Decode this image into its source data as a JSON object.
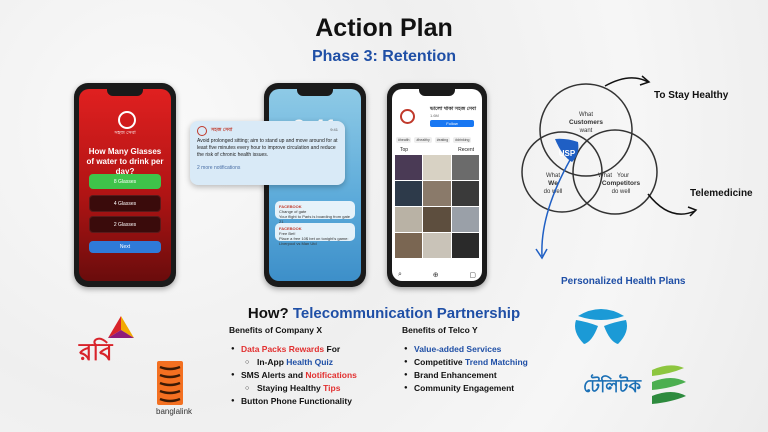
{
  "title": "Action Plan",
  "subtitle": "Phase 3: Retention",
  "phone1": {
    "app_name": "সহজ সেবা",
    "question": "How Many Glasses of water to drink per day?",
    "options": [
      "8 Glasses",
      "4 Glasses",
      "2 Glasses"
    ],
    "next_label": "Next"
  },
  "phone2": {
    "time": "9:41",
    "notification": {
      "app": "সহজ সেবা",
      "time": "9:41",
      "body": "Avoid prolonged sitting; aim to stand up and move around for at least five minutes every hour to improve circulation and reduce the risk of chronic health issues.",
      "more": "2 more notifications"
    },
    "small_notifications": [
      {
        "head": "FACEBOOK",
        "line1": "Change of gate",
        "line2": "Your flight to Paris is boarding from gate 21"
      },
      {
        "head": "FACEBOOK",
        "line1": "Free Bet!",
        "line2": "Place a free 10$ bet on tonight's game: Liverpool vs Man Utd"
      }
    ]
  },
  "phone3": {
    "page_title": "ভালো থাকা সহজ সেবা",
    "followers": "1.6M",
    "follow_label": "Follow",
    "chips": [
      "#health",
      "#healthy",
      "#eating",
      "#drinking"
    ],
    "tabs": [
      "Top",
      "Recent"
    ]
  },
  "venn": {
    "circle_top": [
      "What",
      "Customers",
      "want"
    ],
    "circle_left": [
      "What",
      "We",
      "do well"
    ],
    "circle_right": [
      "What",
      "Your",
      "Competitors",
      "do well"
    ],
    "center": "USP",
    "label_stay_healthy": "To Stay Healthy",
    "label_telemedicine": "Telemedicine",
    "label_personalized": "Personalized Health Plans"
  },
  "how": {
    "prefix": "How?",
    "highlight": "Telecommunication Partnership"
  },
  "company_x": {
    "heading": "Benefits of Company X",
    "items": [
      {
        "parts": [
          {
            "t": "Data Packs Rewards",
            "c": "red"
          },
          {
            "t": " For",
            "c": ""
          }
        ]
      },
      {
        "sub": true,
        "parts": [
          {
            "t": "In-App ",
            "c": ""
          },
          {
            "t": "Health Quiz",
            "c": "blu"
          }
        ]
      },
      {
        "parts": [
          {
            "t": "SMS Alerts and ",
            "c": ""
          },
          {
            "t": "Notifications",
            "c": "red"
          }
        ]
      },
      {
        "sub": true,
        "parts": [
          {
            "t": "Staying Healthy ",
            "c": ""
          },
          {
            "t": "Tips",
            "c": "red"
          }
        ]
      },
      {
        "parts": [
          {
            "t": "Button Phone Functionality",
            "c": ""
          }
        ]
      }
    ]
  },
  "telco_y": {
    "heading": "Benefits of Telco Y",
    "items": [
      {
        "parts": [
          {
            "t": "Value-added Services",
            "c": "blu"
          }
        ]
      },
      {
        "parts": [
          {
            "t": "Competitive ",
            "c": ""
          },
          {
            "t": "Trend Matching",
            "c": "blu"
          }
        ]
      },
      {
        "parts": [
          {
            "t": "Brand Enhancement",
            "c": ""
          }
        ]
      },
      {
        "parts": [
          {
            "t": "Community Engagement",
            "c": ""
          }
        ]
      }
    ]
  },
  "logos": {
    "robi": "রবি",
    "banglalink": "banglalink",
    "teletalk": "টেলিটক"
  },
  "colors": {
    "accent_blue": "#1f4fa6",
    "accent_red": "#e23030",
    "option_green": "#3fc34a"
  }
}
